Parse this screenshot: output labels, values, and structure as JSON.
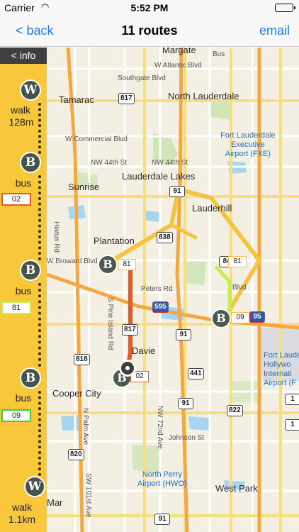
{
  "status": {
    "carrier": "Carrier",
    "time": "5:52 PM"
  },
  "nav": {
    "back_label": "< back",
    "title": "11 routes",
    "email_label": "email"
  },
  "sidebar": {
    "info_label": "< info",
    "legs": [
      {
        "icon": "W",
        "mode": "walk",
        "detail": "128m"
      },
      {
        "icon": "B",
        "mode": "bus",
        "route": "02",
        "route_color": "#e65a2a"
      },
      {
        "icon": "B",
        "mode": "bus",
        "route": "81",
        "route_color": "#c6ef52"
      },
      {
        "icon": "B",
        "mode": "bus",
        "route": "09",
        "route_color": "#3fcf3a"
      },
      {
        "icon": "W",
        "mode": "walk",
        "detail": "1.1km"
      }
    ]
  },
  "map": {
    "towns": [
      "Margate",
      "Tamarac",
      "North Lauderdale",
      "Lauderdale Lakes",
      "Sunrise",
      "Lauderhill",
      "Plantation",
      "Davie",
      "Cooper City",
      "West Park"
    ],
    "roads": [
      "W Atlantic Blvd",
      "Southgate Blvd",
      "W Commercial Blvd",
      "NW 44th St",
      "NW 44th St",
      "W Broward Blvd",
      "Peters Rd",
      "Blvd",
      "Johnson St",
      "Hiatus Rd",
      "S Pine Island Rd",
      "NW 72nd Ave",
      "N Palm Ave",
      "SW 101st Ave",
      "Bus",
      "Mar"
    ],
    "airports": {
      "fxe": [
        "Fort Lauderdale",
        "Executive",
        "Airport (FXE)"
      ],
      "hwo": [
        "North Perry",
        "Airport (HWO)"
      ],
      "fll": [
        "Fort Laude",
        "Hollywo",
        "Internati",
        "Airport (F"
      ]
    },
    "highways": [
      "817",
      "91",
      "838",
      "84",
      "595",
      "817",
      "91",
      "818",
      "441",
      "91",
      "822",
      "820",
      "95",
      "91",
      "1",
      "1"
    ],
    "stops": [
      {
        "icon": "B",
        "route": "81",
        "color": "#f5c342"
      },
      {
        "icon": "B",
        "route": "09",
        "color": "#f5c342"
      },
      {
        "icon": "B",
        "route": "81",
        "color": "#f5c342"
      },
      {
        "icon": "B",
        "route": "02",
        "color": "#e65a2a"
      }
    ],
    "route_colors": {
      "yellow": "#f5c342",
      "orange": "#e65a2a",
      "lime": "#c6ef52"
    }
  }
}
